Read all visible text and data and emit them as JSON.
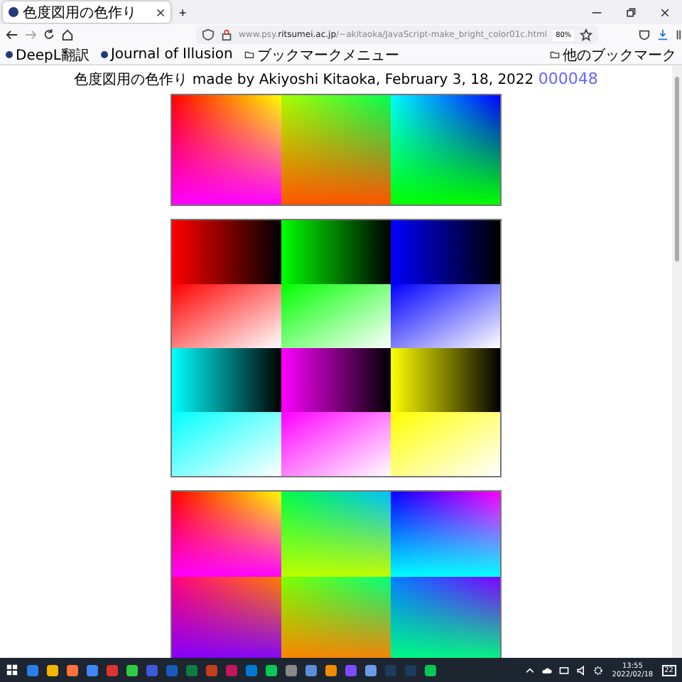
{
  "browser": {
    "tab_title": "色度図用の色作り",
    "new_tab": "+",
    "url_prefix": "www.psy.",
    "url_domain": "ritsumei.ac.jp",
    "url_path": "/~akitaoka/JavaScript-make_bright_color01c.html",
    "zoom": "80%"
  },
  "bookmarks": [
    {
      "label": "DeepL翻訳",
      "kind": "site"
    },
    {
      "label": "Journal of Illusion",
      "kind": "site"
    },
    {
      "label": "ブックマークメニュー",
      "kind": "folder"
    }
  ],
  "other_bookmarks": "他のブックマーク",
  "page": {
    "title": "色度図用の色作り made by Akiyoshi Kitaoka, February 3, 18, 2022",
    "counter": "000048"
  },
  "taskbar": {
    "time": "13:55",
    "date": "2022/02/18",
    "notifications": "22"
  }
}
